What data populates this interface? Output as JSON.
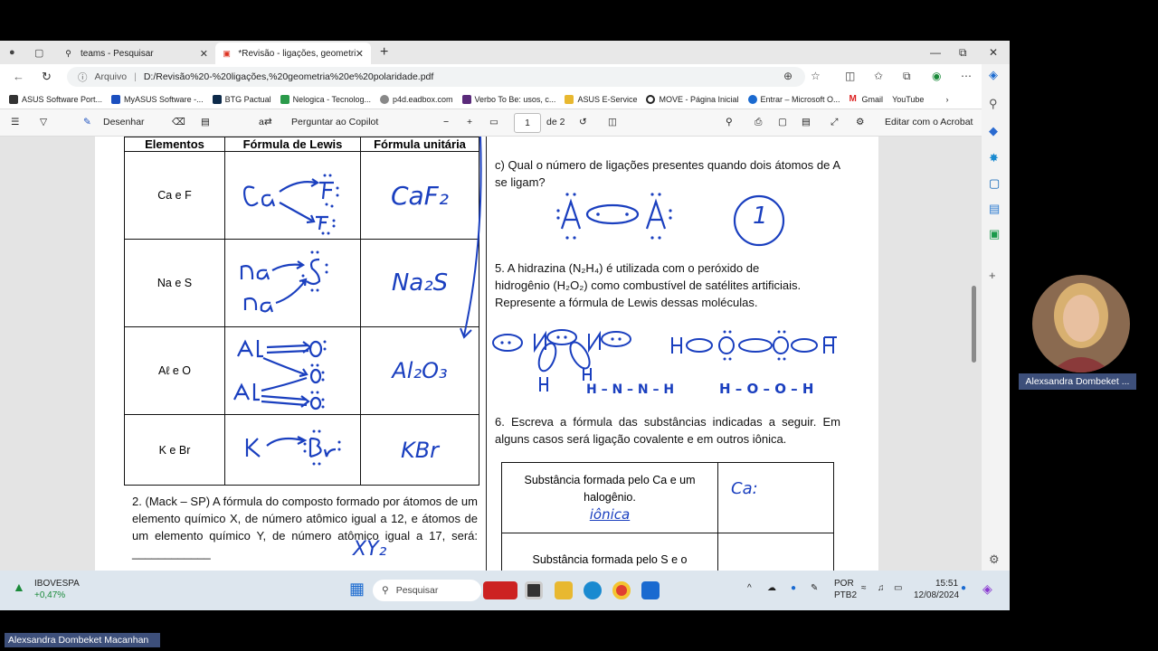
{
  "browser": {
    "tabs": [
      {
        "label": "teams - Pesquisar"
      },
      {
        "label": "*Revisão - ligações, geometria e..."
      }
    ],
    "address": {
      "prefix": "Arquivo",
      "url": "D:/Revisão%20-%20ligações,%20geometria%20e%20polaridade.pdf"
    },
    "bookmarks": [
      "ASUS Software Port...",
      "MyASUS Software -...",
      "BTG Pactual",
      "Nelogica - Tecnolog...",
      "p4d.eadbox.com",
      "Verbo To Be: usos, c...",
      "ASUS E-Service",
      "MOVE - Página Inicial",
      "Entrar – Microsoft O...",
      "Gmail",
      "YouTube"
    ]
  },
  "pdf_toolbar": {
    "draw": "Desenhar",
    "copilot": "Perguntar ao Copilot",
    "page": "1",
    "of": "de 2",
    "acrobat": "Editar com o Acrobat"
  },
  "doc": {
    "table_headers": [
      "Elementos",
      "Fórmula de Lewis",
      "Fórmula unitária"
    ],
    "rows": [
      {
        "el": "Ca e F",
        "formula": "CaF₂"
      },
      {
        "el": "Na e S",
        "formula": "Na₂S"
      },
      {
        "el": "Aℓ e O",
        "formula": "Al₂O₃"
      },
      {
        "el": "K e Br",
        "formula": "KBr"
      }
    ],
    "q2": "2. (Mack – SP) A fórmula do composto formado por átomos de um elemento químico X, de número atômico igual a 12, e átomos de um elemento químico Y, de número atômico igual a 17, será: ____________",
    "q2_answer": "XY₂",
    "qc": "c) Qual o número de ligações presentes quando dois átomos de A se ligam?",
    "qc_answer": "1",
    "q5_line1": "5. A hidrazina (N₂H₄) é utilizada com o peróxido de",
    "q5_line2": "hidrogênio (H₂O₂) como combustível de satélites artificiais.",
    "q5_line3": "Represente a fórmula de Lewis dessas moléculas.",
    "hydrazine": "H – N – N – H",
    "peroxide": "H – O – O – H",
    "q6": "6. Escreva a fórmula das substâncias indicadas a seguir. Em alguns casos será ligação covalente e em outros iônica.",
    "sub1": "Substância formada pelo Ca e um halogênio.",
    "sub1_hw": "iônica",
    "sub1_ans": "Ca:",
    "sub2": "Substância formada pelo S e o"
  },
  "taskbar": {
    "stock_name": "IBOVESPA",
    "stock_change": "+0,47%",
    "search": "Pesquisar",
    "lang1": "POR",
    "lang2": "PTB2",
    "time": "15:51",
    "date": "12/08/2024"
  },
  "participants": {
    "cam_name": "Alexsandra Dombeket ...",
    "host_name": "Alexsandra Dombeket Macanhan"
  }
}
